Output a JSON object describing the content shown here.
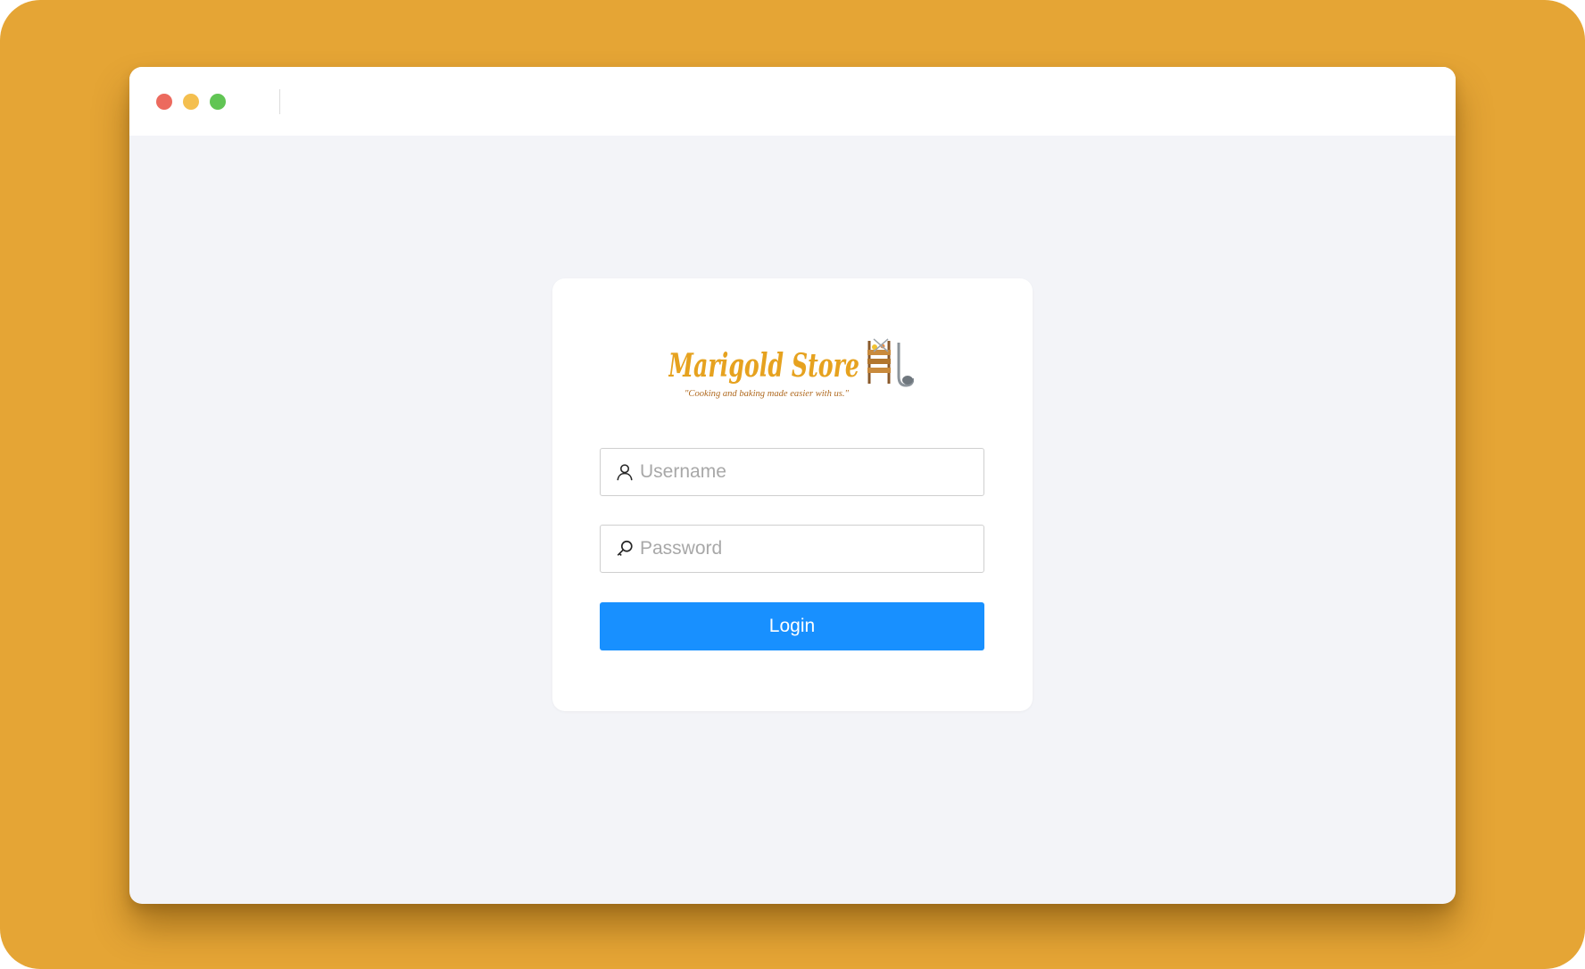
{
  "window": {
    "controls": [
      "close",
      "minimize",
      "maximize"
    ]
  },
  "logo": {
    "title": "Marigold Store",
    "tagline": "\"Cooking and baking made easier with us.\"",
    "brand_color": "#E6A21F"
  },
  "form": {
    "username": {
      "placeholder": "Username",
      "value": "",
      "icon": "user-icon"
    },
    "password": {
      "placeholder": "Password",
      "value": "",
      "icon": "key-icon"
    },
    "login_label": "Login"
  },
  "colors": {
    "backdrop": "#E5A535",
    "page": "#F3F4F8",
    "primary_button": "#1890FF",
    "close": "#EC6A5E",
    "minimize": "#F4BF4F",
    "maximize": "#61C554"
  }
}
